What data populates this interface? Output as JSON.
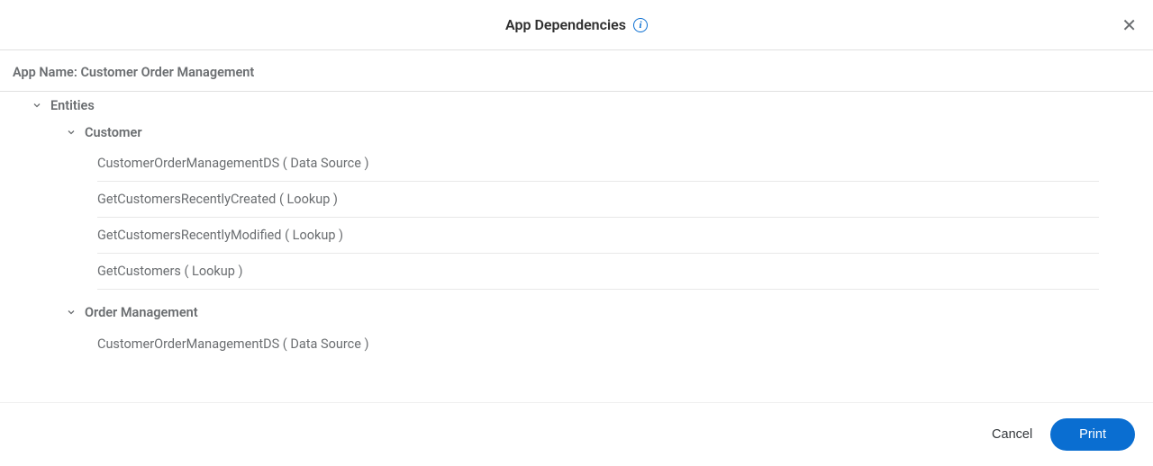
{
  "header": {
    "title": "App Dependencies"
  },
  "subheader": {
    "label": "App Name:",
    "value": "Customer Order Management"
  },
  "tree": {
    "root_label": "Entities",
    "nodes": [
      {
        "label": "Customer",
        "items": [
          "CustomerOrderManagementDS ( Data Source )",
          "GetCustomersRecentlyCreated ( Lookup )",
          "GetCustomersRecentlyModified ( Lookup )",
          "GetCustomers ( Lookup )"
        ]
      },
      {
        "label": "Order Management",
        "items": [
          "CustomerOrderManagementDS ( Data Source )"
        ]
      }
    ]
  },
  "footer": {
    "cancel": "Cancel",
    "print": "Print"
  }
}
